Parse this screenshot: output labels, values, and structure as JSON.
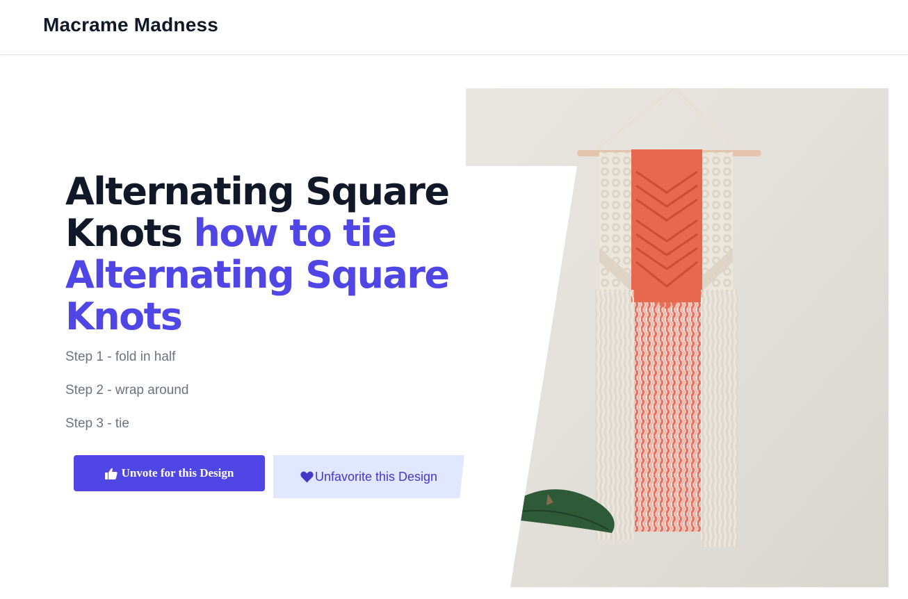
{
  "header": {
    "brand": "Macrame Madness"
  },
  "hero": {
    "title_dark": "Alternating Square Knots",
    "title_accent": "how to tie Alternating Square Knots",
    "steps": [
      "Step 1 - fold in half",
      "Step 2 - wrap around",
      "Step 3 - tie"
    ]
  },
  "actions": {
    "vote_label": "Unvote for this Design",
    "vote_icon": "thumbs-up-icon",
    "favorite_label": "Unfavorite this Design",
    "favorite_icon": "heart-icon"
  },
  "colors": {
    "accent": "#4f46e5",
    "accent_light": "#e0e7ff",
    "heading": "#111827",
    "muted": "#6b7280",
    "macrame_coral": "#e8705c",
    "macrame_cream": "#ece6dc"
  },
  "image": {
    "alt": "Macrame wall hanging with coral chevron center and cream side panels"
  }
}
